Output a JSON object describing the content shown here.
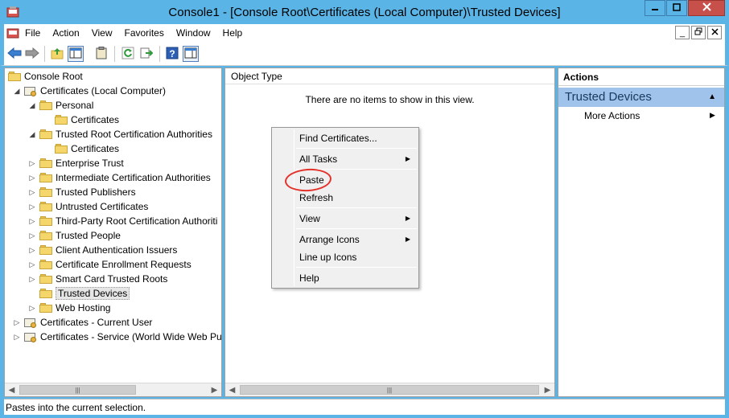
{
  "window": {
    "title": "Console1 - [Console Root\\Certificates (Local Computer)\\Trusted Devices]"
  },
  "menubar": [
    "File",
    "Action",
    "View",
    "Favorites",
    "Window",
    "Help"
  ],
  "tree": {
    "items": [
      "Console Root",
      "Certificates (Local Computer)",
      "Personal",
      "Certificates",
      "Trusted Root Certification Authorities",
      "Certificates",
      "Enterprise Trust",
      "Intermediate Certification Authorities",
      "Trusted Publishers",
      "Untrusted Certificates",
      "Third-Party Root Certification Authoriti",
      "Trusted People",
      "Client Authentication Issuers",
      "Certificate Enrollment Requests",
      "Smart Card Trusted Roots",
      "Trusted Devices",
      "Web Hosting",
      "Certificates - Current User",
      "Certificates - Service (World Wide Web Pub"
    ]
  },
  "center": {
    "column_header": "Object Type",
    "empty_message": "There are no items to show in this view."
  },
  "context_menu": {
    "items": [
      "Find Certificates...",
      "All Tasks",
      "Paste",
      "Refresh",
      "View",
      "Arrange Icons",
      "Line up Icons",
      "Help"
    ]
  },
  "actions": {
    "header": "Actions",
    "section": "Trusted Devices",
    "item": "More Actions"
  },
  "status": "Pastes into the current selection.",
  "colors": {
    "titlebar": "#5ab4e6",
    "close": "#c7504b",
    "action_section": "#9fc3ea",
    "annotation": "#e3322a"
  }
}
